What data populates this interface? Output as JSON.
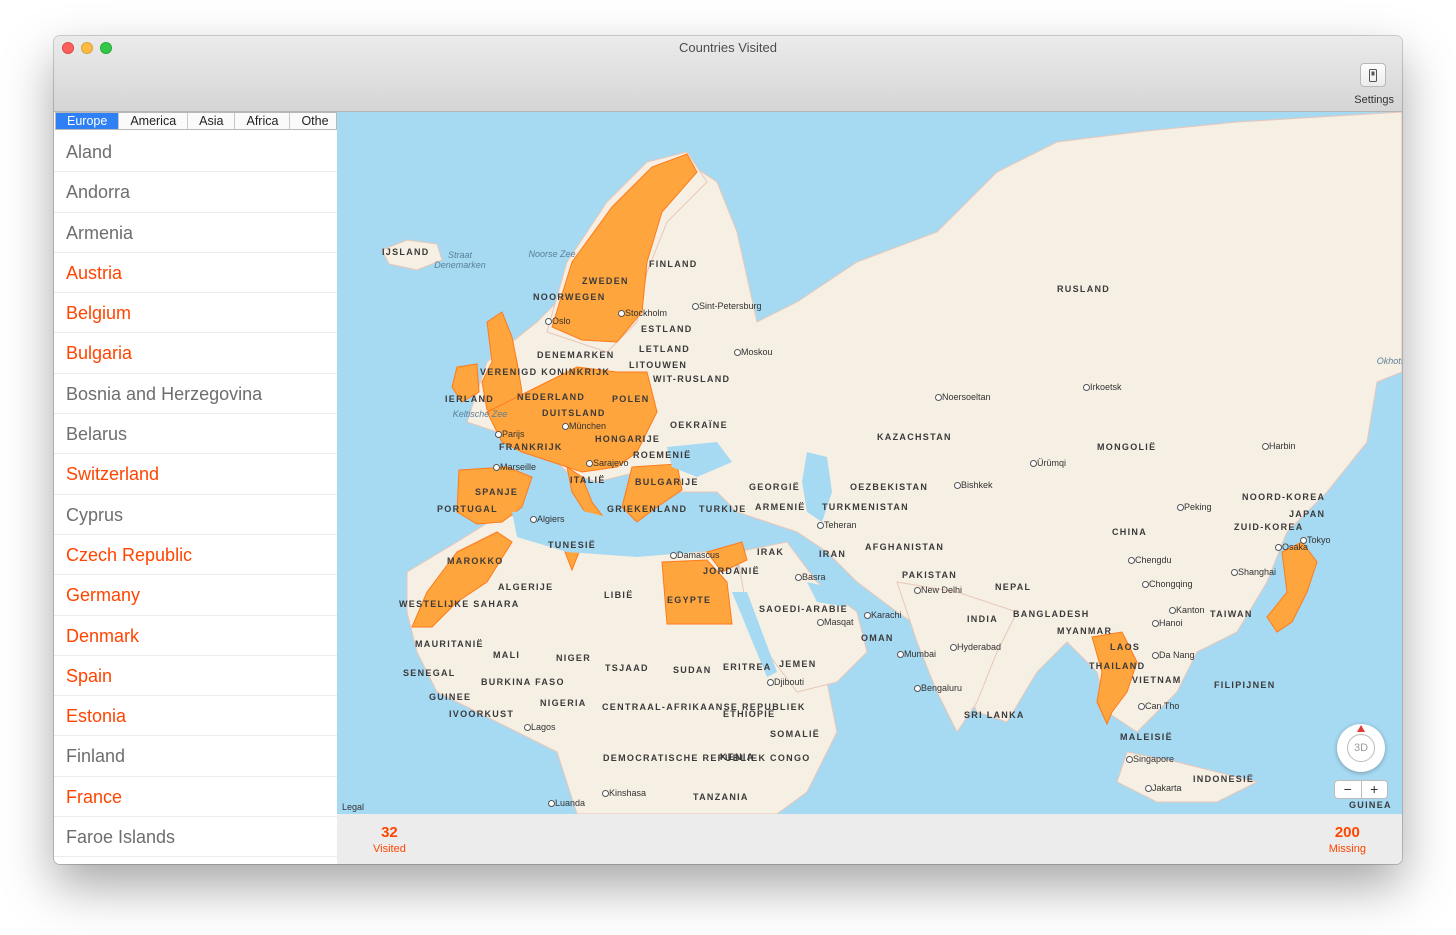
{
  "window": {
    "title": "Countries Visited",
    "settings_label": "Settings"
  },
  "tabs": [
    {
      "label": "Europe",
      "active": true
    },
    {
      "label": "America",
      "active": false
    },
    {
      "label": "Asia",
      "active": false
    },
    {
      "label": "Africa",
      "active": false
    },
    {
      "label": "Othe",
      "active": false
    }
  ],
  "countries": [
    {
      "name": "Aland",
      "visited": false
    },
    {
      "name": "Andorra",
      "visited": false
    },
    {
      "name": "Armenia",
      "visited": false
    },
    {
      "name": "Austria",
      "visited": true
    },
    {
      "name": "Belgium",
      "visited": true
    },
    {
      "name": "Bulgaria",
      "visited": true
    },
    {
      "name": "Bosnia and Herzegovina",
      "visited": false
    },
    {
      "name": "Belarus",
      "visited": false
    },
    {
      "name": "Switzerland",
      "visited": true
    },
    {
      "name": "Cyprus",
      "visited": false
    },
    {
      "name": "Czech Republic",
      "visited": true
    },
    {
      "name": "Germany",
      "visited": true
    },
    {
      "name": "Denmark",
      "visited": true
    },
    {
      "name": "Spain",
      "visited": true
    },
    {
      "name": "Estonia",
      "visited": true
    },
    {
      "name": "Finland",
      "visited": false
    },
    {
      "name": "France",
      "visited": true
    },
    {
      "name": "Faroe Islands",
      "visited": false
    }
  ],
  "colors": {
    "visited_text": "#ff4500",
    "unvisited_text": "#6e6e6e",
    "visited_fill": "#ffa53d",
    "sea": "#a6d9f2",
    "land": "#f6efe4",
    "tab_active": "#2f80f6"
  },
  "map": {
    "country_labels": [
      "IJSLAND",
      "FINLAND",
      "ZWEDEN",
      "NOORWEGEN",
      "ESTLAND",
      "LETLAND",
      "LITOUWEN",
      "DENEMARKEN",
      "VERENIGD KONINKRIJK",
      "IERLAND",
      "NEDERLAND",
      "DUITSLAND",
      "POLEN",
      "WIT-RUSLAND",
      "OEKRAÏNE",
      "FRANKRIJK",
      "HONGARIJE",
      "ROEMENIË",
      "SPANJE",
      "PORTUGAL",
      "ITALIË",
      "BULGARIJE",
      "GRIEKENLAND",
      "TURKIJE",
      "GEORGIË",
      "ARMENIË",
      "RUSLAND",
      "KAZACHSTAN",
      "OEZBEKISTAN",
      "TURKMENISTAN",
      "AFGHANISTAN",
      "IRAN",
      "IRAK",
      "PAKISTAN",
      "INDIA",
      "NEPAL",
      "BANGLADESH",
      "MONGOLIË",
      "CHINA",
      "NOORD-KOREA",
      "ZUID-KOREA",
      "JAPAN",
      "TAIWAN",
      "MYANMAR",
      "LAOS",
      "THAILAND",
      "VIETNAM",
      "FILIPIJNEN",
      "MALEISIË",
      "INDONESIË",
      "SRI LANKA",
      "TUNESIË",
      "MAROKKO",
      "ALGERIJE",
      "LIBIË",
      "EGYPTE",
      "JORDANIË",
      "SAOEDI-ARABIE",
      "JEMEN",
      "OMAN",
      "WESTELIJKE SAHARA",
      "MAURITANIË",
      "SENEGAL",
      "MALI",
      "NIGER",
      "TSJAAD",
      "SUDAN",
      "ERITREA",
      "ETHIOPIË",
      "SOMALIË",
      "KENIA",
      "BURKINA FASO",
      "GUINEE",
      "IVOORKUST",
      "NIGERIA",
      "CENTRAAL-AFRIKAANSE REPUBLIEK",
      "DEMOCRATISCHE REPUBLIEK CONGO",
      "TANZANIA",
      "GUINEA"
    ],
    "cities": [
      "Stockholm",
      "Oslo",
      "Sint-Petersburg",
      "Moskou",
      "Parijs",
      "München",
      "Marseille",
      "Sarajevo",
      "Algiers",
      "Damascus",
      "Basra",
      "Teheran",
      "Masqat",
      "Karachi",
      "New Delhi",
      "Mumbai",
      "Hyderabad",
      "Bengaluru",
      "Bishkek",
      "Noersoeltan",
      "Ürümqi",
      "Irkoetsk",
      "Harbin",
      "Peking",
      "Tokyo",
      "Osaka",
      "Shanghai",
      "Chengdu",
      "Chongqing",
      "Kanton",
      "Hanoi",
      "Da Nang",
      "Can Tho",
      "Singapore",
      "Jakarta",
      "Djibouti",
      "Lagos",
      "Kinshasa",
      "Luanda"
    ],
    "seas": [
      "Straat Denemarken",
      "Noorse Zee",
      "Keltische Zee",
      "Okhots Mor"
    ],
    "legal": "Legal",
    "compass_label": "3D",
    "zoom_out": "−",
    "zoom_in": "+"
  },
  "stats": {
    "visited": {
      "value": "32",
      "label": "Visited"
    },
    "missing": {
      "value": "200",
      "label": "Missing"
    }
  }
}
